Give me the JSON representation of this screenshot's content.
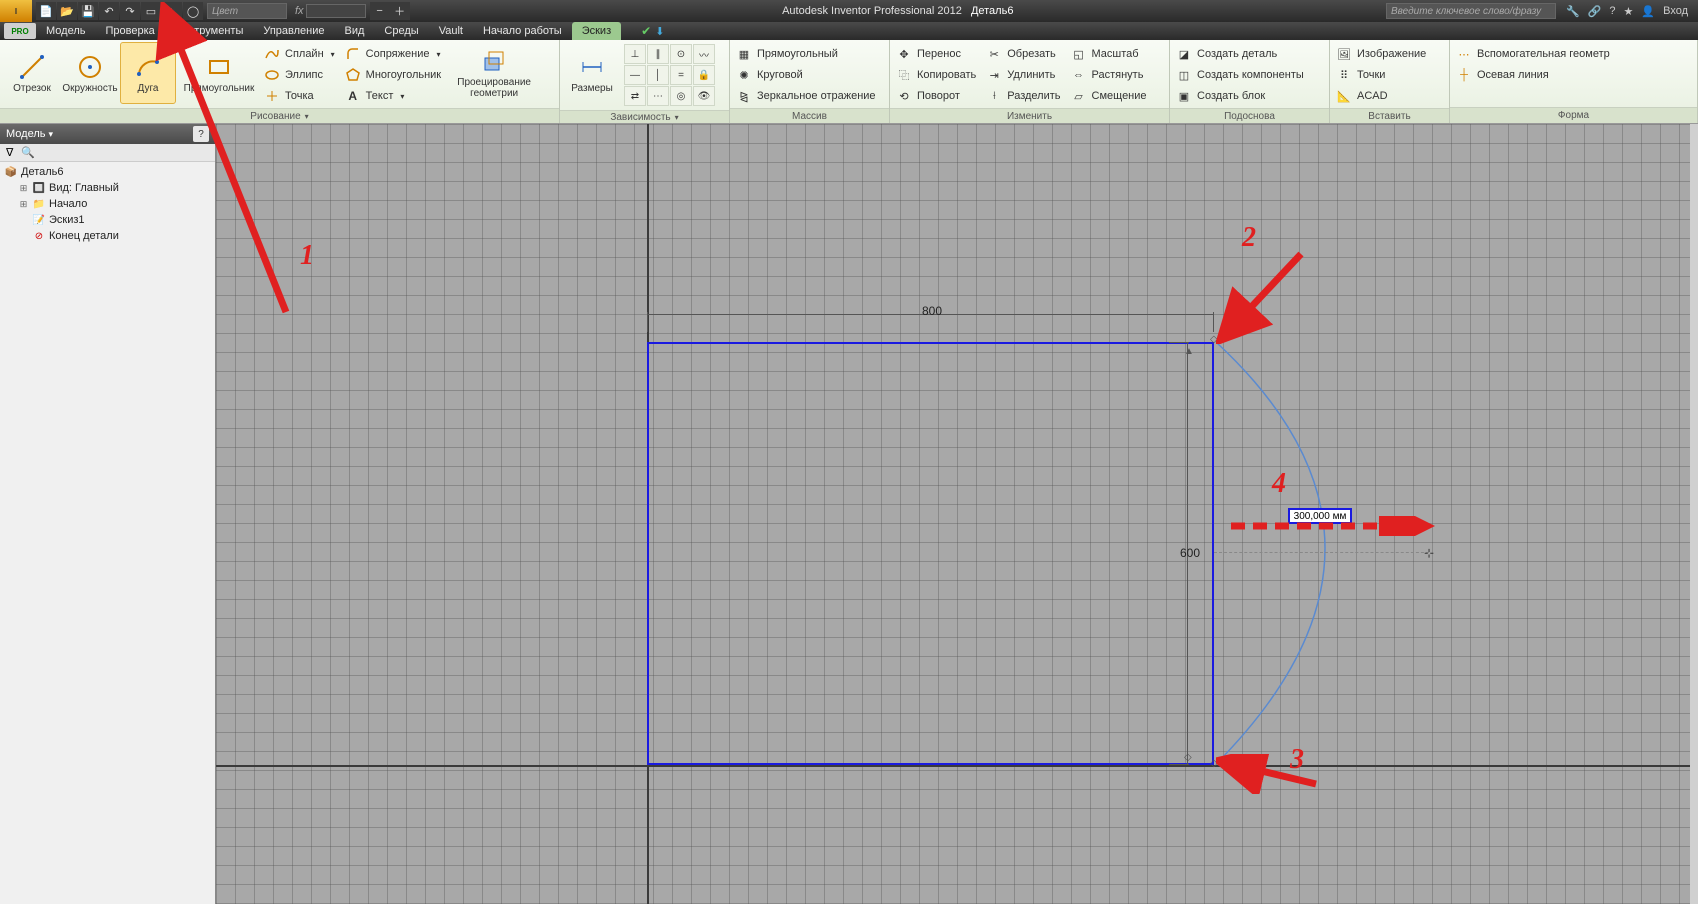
{
  "title": {
    "app": "Autodesk Inventor Professional 2012",
    "doc": "Деталь6"
  },
  "qat_color_placeholder": "Цвет",
  "search_placeholder": "Введите ключевое слово/фразу",
  "login_label": "Вход",
  "fx_label": "fx",
  "pro_badge": "PRO",
  "menus": [
    "Модель",
    "Проверка",
    "Инструменты",
    "Управление",
    "Вид",
    "Среды",
    "Vault",
    "Начало работы",
    "Эскиз"
  ],
  "active_menu": 8,
  "finish_sketch_tooltip": "Завершить эскиз",
  "ribbon": {
    "draw": {
      "label": "Рисование",
      "segment": "Отрезок",
      "circle": "Окружность",
      "arc": "Дуга",
      "rectangle": "Прямоугольник",
      "spline": "Сплайн",
      "ellipse": "Эллипс",
      "point": "Точка",
      "fillet": "Сопряжение",
      "polygon": "Многоугольник",
      "text": "Текст",
      "project": "Проецирование геометрии"
    },
    "constrain": {
      "label": "Зависимость",
      "dimension": "Размеры"
    },
    "pattern": {
      "label": "Массив",
      "rect": "Прямоугольный",
      "circ": "Круговой",
      "mirror": "Зеркальное отражение"
    },
    "modify": {
      "label": "Изменить",
      "move": "Перенос",
      "copy": "Копировать",
      "rotate": "Поворот",
      "trim": "Обрезать",
      "extend": "Удлинить",
      "split": "Разделить",
      "scale": "Масштаб",
      "stretch": "Растянуть",
      "offset": "Смещение"
    },
    "layout": {
      "label": "Подоснова",
      "create_part": "Создать деталь",
      "create_comp": "Создать компоненты",
      "create_block": "Создать блок"
    },
    "insert": {
      "label": "Вставить",
      "image": "Изображение",
      "points": "Точки",
      "acad": "ACAD"
    },
    "format": {
      "label": "Форма",
      "construction": "Вспомогательная геометр",
      "centerline": "Осевая линия"
    }
  },
  "model_panel": {
    "title": "Модель",
    "root": "Деталь6",
    "view": "Вид: Главный",
    "origin": "Начало",
    "sketch": "Эскиз1",
    "end": "Конец детали"
  },
  "sketch": {
    "dim_width": "800",
    "dim_height": "600",
    "input_value": "300,000 мм"
  },
  "annotations": {
    "n1": "1",
    "n2": "2",
    "n3": "3",
    "n4": "4"
  }
}
